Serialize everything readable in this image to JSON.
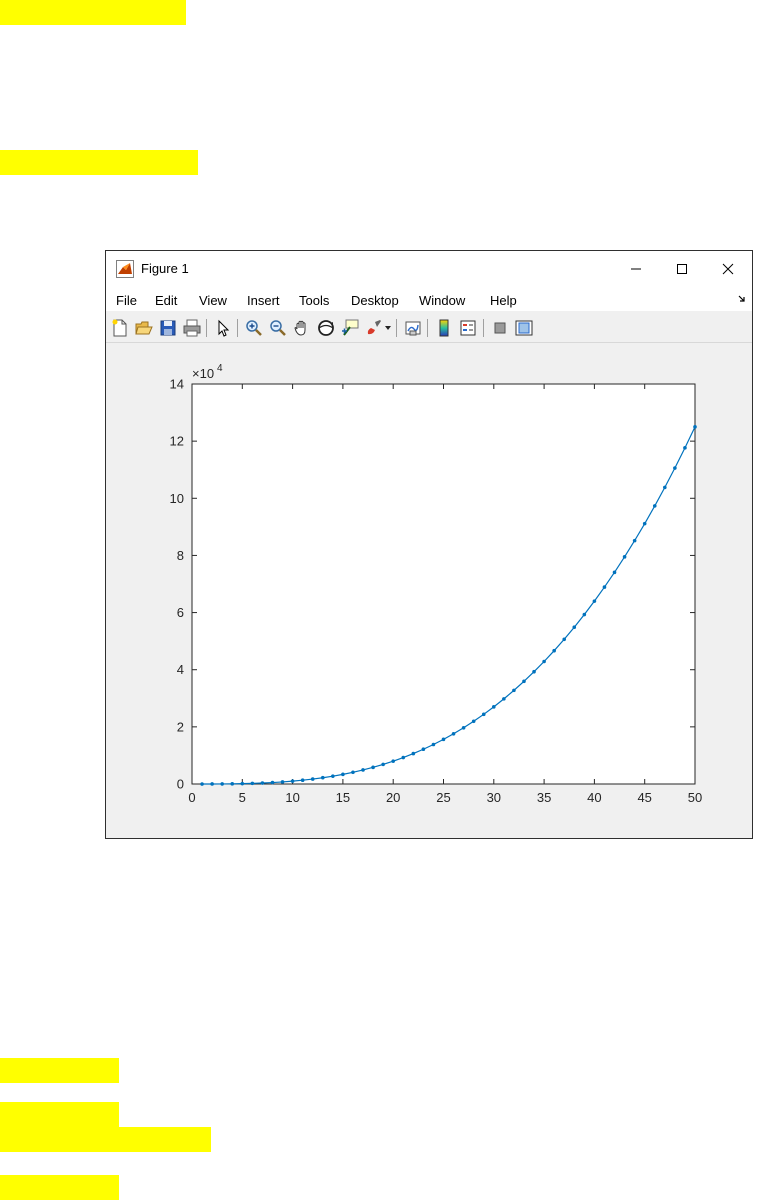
{
  "window": {
    "title": "Figure 1",
    "controls": {
      "minimize": "—",
      "maximize": "☐",
      "close": "✕"
    }
  },
  "menu": [
    "File",
    "Edit",
    "View",
    "Insert",
    "Tools",
    "Desktop",
    "Window",
    "Help"
  ],
  "toolbar": {
    "icons": [
      "new-figure-icon",
      "open-file-icon",
      "save-icon",
      "print-icon",
      "select-arrow-icon",
      "zoom-in-icon",
      "zoom-out-icon",
      "pan-hand-icon",
      "rotate-3d-icon",
      "data-cursor-icon",
      "brush-icon",
      "brush-dropdown-icon",
      "link-plot-icon",
      "insert-colorbar-icon",
      "insert-legend-icon",
      "hide-plot-tools-icon",
      "show-plot-tools-icon"
    ]
  },
  "highlights": 6,
  "colors": {
    "highlight": "#ffff00",
    "series": "#0072bd",
    "window_bg": "#f0f0f0"
  },
  "chart_data": {
    "type": "line",
    "title": "",
    "xlabel": "",
    "ylabel": "",
    "xlim": [
      0,
      50
    ],
    "ylim": [
      0,
      140000
    ],
    "y_exponent_label": "×10",
    "y_exponent": "4",
    "xticks": [
      0,
      5,
      10,
      15,
      20,
      25,
      30,
      35,
      40,
      45,
      50
    ],
    "yticks": [
      0,
      20000,
      40000,
      60000,
      80000,
      100000,
      120000,
      140000
    ],
    "ytick_labels": [
      "0",
      "2",
      "4",
      "6",
      "8",
      "10",
      "12",
      "14"
    ],
    "marker": "point",
    "grid": false,
    "series": [
      {
        "x": [
          1,
          2,
          3,
          4,
          5,
          6,
          7,
          8,
          9,
          10,
          11,
          12,
          13,
          14,
          15,
          16,
          17,
          18,
          19,
          20,
          21,
          22,
          23,
          24,
          25,
          26,
          27,
          28,
          29,
          30,
          31,
          32,
          33,
          34,
          35,
          36,
          37,
          38,
          39,
          40,
          41,
          42,
          43,
          44,
          45,
          46,
          47,
          48,
          49,
          50
        ],
        "y": [
          1,
          8,
          27,
          64,
          125,
          216,
          343,
          512,
          729,
          1000,
          1331,
          1728,
          2197,
          2744,
          3375,
          4096,
          4913,
          5832,
          6859,
          8000,
          9261,
          10648,
          12167,
          13824,
          15625,
          17576,
          19683,
          21952,
          24389,
          27000,
          29791,
          32768,
          35937,
          39304,
          42875,
          46656,
          50653,
          54872,
          59319,
          64000,
          68921,
          74088,
          79507,
          85184,
          91125,
          97336,
          103823,
          110592,
          117649,
          125000
        ]
      }
    ]
  }
}
